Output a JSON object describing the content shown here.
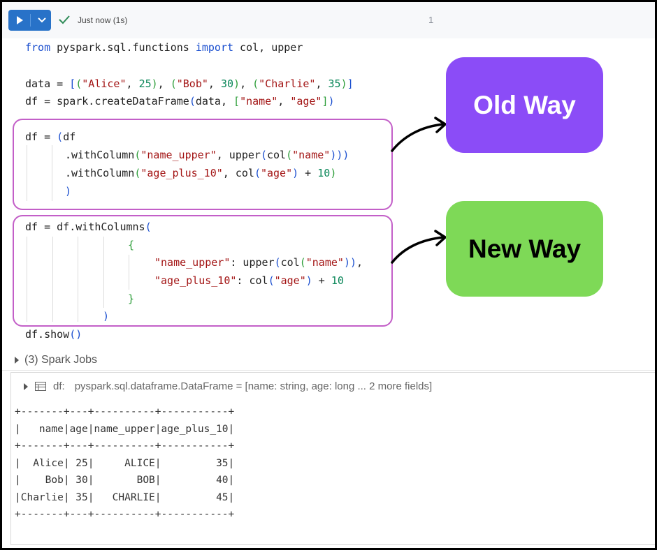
{
  "toolbar": {
    "status": "Just now (1s)",
    "cell_number": "1"
  },
  "code": {
    "import_line": {
      "from": "from",
      "module": " pyspark.sql.functions ",
      "import": "import",
      "names": " col, upper"
    },
    "data_line": {
      "prefix": "data = ",
      "open": "[",
      "t1a": "(",
      "s1": "\"Alice\"",
      "n1": "25",
      "t1b": ")",
      "t2a": "(",
      "s2": "\"Bob\"",
      "n2": "30",
      "t2b": ")",
      "t3a": "(",
      "s3": "\"Charlie\"",
      "n3": "35",
      "t3b": ")",
      "close": "]"
    },
    "create_line": {
      "prefix": "df = spark.createDataFrame",
      "open": "(",
      "arg": "data, ",
      "lopen": "[",
      "s1": "\"name\"",
      "s2": "\"age\"",
      "lclose": "]",
      "close": ")"
    },
    "old": {
      "l1": {
        "prefix": "df = ",
        "open": "(",
        "rest": "df"
      },
      "l2": {
        "method": ".withColumn",
        "open": "(",
        "s1": "\"name_upper\"",
        "mid": ", upper",
        "p1": "(",
        "fn": "col",
        "p2": "(",
        "s2": "\"name\"",
        "p3": ")))"
      },
      "l3": {
        "method": ".withColumn",
        "open": "(",
        "s1": "\"age_plus_10\"",
        "mid": ", col",
        "p1": "(",
        "s2": "\"age\"",
        "p2": ")",
        "op": " + ",
        "n": "10",
        "p3": ")"
      },
      "l4": {
        "close": ")"
      }
    },
    "new": {
      "l1": {
        "prefix": "df = df.withColumns",
        "open": "("
      },
      "l2": {
        "brace": "{"
      },
      "l3": {
        "s1": "\"name_upper\"",
        "mid": ": upper",
        "p1": "(",
        "fn": "col",
        "p2": "(",
        "s2": "\"name\"",
        "p3": "))",
        "comma": ","
      },
      "l4": {
        "s1": "\"age_plus_10\"",
        "mid": ": col",
        "p1": "(",
        "s2": "\"age\"",
        "p2": ")",
        "op": " + ",
        "n": "10"
      },
      "l5": {
        "brace": "}"
      },
      "l6": {
        "close": ")"
      }
    },
    "show_line": {
      "text": "df.show",
      "parens": "()"
    }
  },
  "labels": {
    "old_way": "Old Way",
    "new_way": "New Way"
  },
  "spark_jobs": "(3) Spark Jobs",
  "dataframe": {
    "name": "df:",
    "type": "pyspark.sql.dataframe.DataFrame = [name: string, age: long ... 2 more fields]"
  },
  "table_output": {
    "border": "+-------+---+----------+-----------+",
    "header": "|   name|age|name_upper|age_plus_10|",
    "rows": [
      "|  Alice| 25|     ALICE|         35|",
      "|    Bob| 30|       BOB|         40|",
      "|Charlie| 35|   CHARLIE|         45|"
    ]
  },
  "colors": {
    "run_button": "#2872c8",
    "old_way_bg": "#8b4cf7",
    "new_way_bg": "#7ed957",
    "box_border": "#c35fc8"
  }
}
